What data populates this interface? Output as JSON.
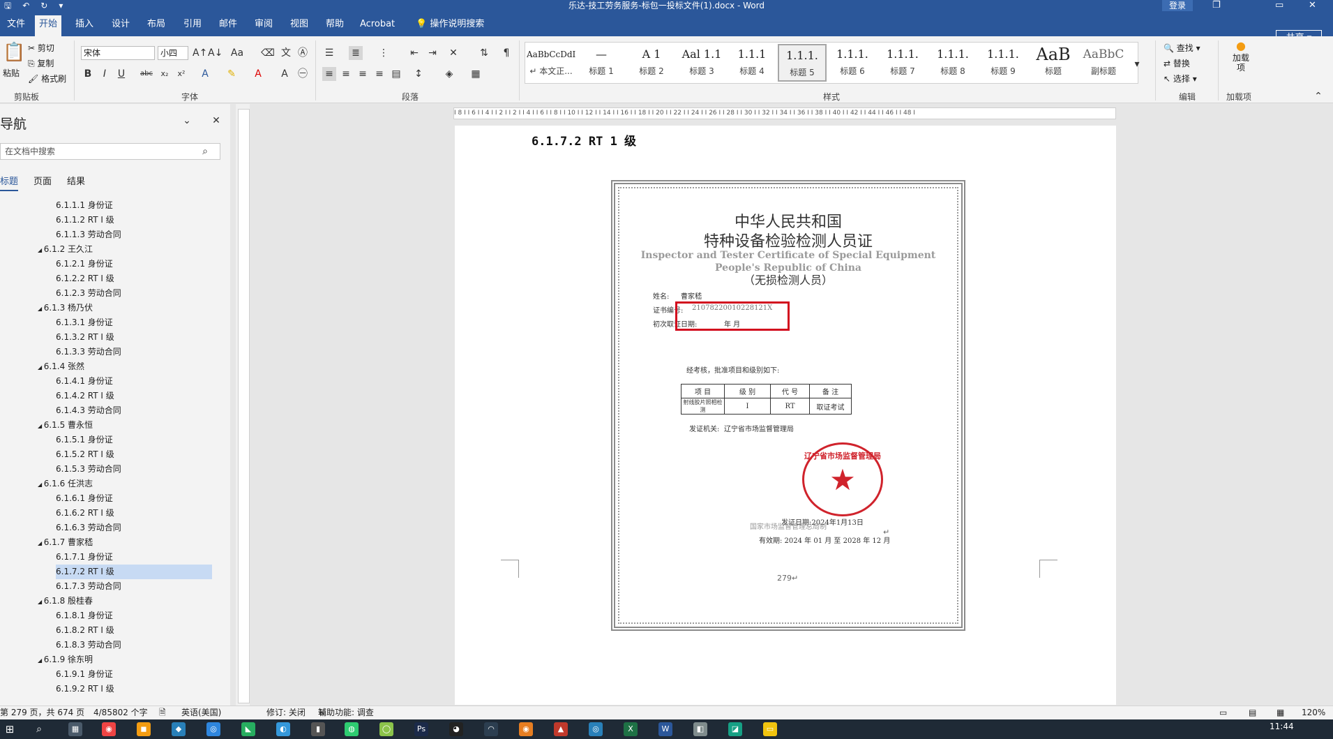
{
  "titlebar": {
    "title": "乐达-技工劳务服务-标包一投标文件(1).docx  -  Word",
    "login": "登录",
    "undo": "↶",
    "redo": "↻",
    "save": "🖫",
    "customize": "▾",
    "restore": "❐",
    "maximize": "▭",
    "close": "✕"
  },
  "tabs": [
    "文件",
    "开始",
    "插入",
    "设计",
    "布局",
    "引用",
    "邮件",
    "审阅",
    "视图",
    "帮助",
    "Acrobat",
    "操作说明搜索"
  ],
  "share": "共享",
  "ribbon": {
    "clipboard": {
      "paste": "粘贴",
      "cut": "剪切",
      "copy": "复制",
      "format_painter": "格式刷",
      "label": "剪贴板"
    },
    "font": {
      "name": "宋体",
      "size": "小四",
      "label": "字体",
      "bold": "B",
      "italic": "I",
      "underline": "U",
      "strike": "abc",
      "sub": "x₂",
      "sup": "x²"
    },
    "paragraph": {
      "label": "段落"
    },
    "styles": {
      "label": "样式",
      "items": [
        {
          "preview": "AaBbCcDdI",
          "name": "↵ 本文正..."
        },
        {
          "preview": "—",
          "name": "标题 1"
        },
        {
          "preview": "A 1",
          "name": "标题 2"
        },
        {
          "preview": "Aal 1.1",
          "name": "标题 3"
        },
        {
          "preview": "1.1.1",
          "name": "标题 4"
        },
        {
          "preview": "1.1.1.",
          "name": "标题 5"
        },
        {
          "preview": "1.1.1.",
          "name": "标题 6"
        },
        {
          "preview": "1.1.1.",
          "name": "标题 7"
        },
        {
          "preview": "1.1.1.",
          "name": "标题 8"
        },
        {
          "preview": "1.1.1.",
          "name": "标题 9"
        },
        {
          "preview": "AaB",
          "name": "标题"
        },
        {
          "preview": "AaBbC",
          "name": "副标题"
        }
      ]
    },
    "editing": {
      "find": "查找",
      "replace": "替换",
      "select": "选择",
      "label": "编辑"
    },
    "addins": {
      "btn": "加载项",
      "label": "加载项"
    }
  },
  "nav": {
    "title": "导航",
    "search_placeholder": "在文档中搜索",
    "tabs": [
      "标题",
      "页面",
      "结果"
    ],
    "tree": [
      {
        "level": 2,
        "text": "6.1.1.1 身份证"
      },
      {
        "level": 2,
        "text": "6.1.1.2 RT I 级"
      },
      {
        "level": 2,
        "text": "6.1.1.3 劳动合同"
      },
      {
        "level": 1,
        "text": "6.1.2 王久江"
      },
      {
        "level": 2,
        "text": "6.1.2.1 身份证"
      },
      {
        "level": 2,
        "text": "6.1.2.2 RT I 级"
      },
      {
        "level": 2,
        "text": "6.1.2.3 劳动合同"
      },
      {
        "level": 1,
        "text": "6.1.3 杨乃伏"
      },
      {
        "level": 2,
        "text": "6.1.3.1 身份证"
      },
      {
        "level": 2,
        "text": "6.1.3.2 RT I 级"
      },
      {
        "level": 2,
        "text": "6.1.3.3 劳动合同"
      },
      {
        "level": 1,
        "text": "6.1.4 张然"
      },
      {
        "level": 2,
        "text": "6.1.4.1 身份证"
      },
      {
        "level": 2,
        "text": "6.1.4.2 RT I 级"
      },
      {
        "level": 2,
        "text": "6.1.4.3 劳动合同"
      },
      {
        "level": 1,
        "text": "6.1.5 曹永恒"
      },
      {
        "level": 2,
        "text": "6.1.5.1 身份证"
      },
      {
        "level": 2,
        "text": "6.1.5.2 RT I 级"
      },
      {
        "level": 2,
        "text": "6.1.5.3 劳动合同"
      },
      {
        "level": 1,
        "text": "6.1.6 任洪志"
      },
      {
        "level": 2,
        "text": "6.1.6.1 身份证"
      },
      {
        "level": 2,
        "text": "6.1.6.2 RT I 级"
      },
      {
        "level": 2,
        "text": "6.1.6.3 劳动合同"
      },
      {
        "level": 1,
        "text": "6.1.7 曹家嵇"
      },
      {
        "level": 2,
        "text": "6.1.7.1 身份证"
      },
      {
        "level": 2,
        "text": "6.1.7.2 RT I 级",
        "selected": true
      },
      {
        "level": 2,
        "text": "6.1.7.3 劳动合同"
      },
      {
        "level": 1,
        "text": "6.1.8 殷桂春"
      },
      {
        "level": 2,
        "text": "6.1.8.1 身份证"
      },
      {
        "level": 2,
        "text": "6.1.8.2 RT I 级"
      },
      {
        "level": 2,
        "text": "6.1.8.3 劳动合同"
      },
      {
        "level": 1,
        "text": "6.1.9 徐东明"
      },
      {
        "level": 2,
        "text": "6.1.9.1 身份证"
      },
      {
        "level": 2,
        "text": "6.1.9.2 RT I 级"
      }
    ]
  },
  "ruler": {
    "h": "I 8 I  I 6 I  I 4 I  I 2 I    I 2 I  I 4 I  I 6 I  I 8 I  I 10 I  I 12 I  I 14 I  I 16 I  I 18 I  I 20 I  I 22 I  I 24 I  I 26 I  I 28 I  I 30 I  I 32 I  I 34 I  I 36 I  I 38 I  I 40 I  I 42 I  I 44 I  I 46 I  I 48 I"
  },
  "document": {
    "heading": "6.1.7.2 RT 1 级",
    "cert": {
      "title1": "中华人民共和国",
      "title2": "特种设备检验检测人员证",
      "en1": "Inspector and Tester Certificate of Special Equipment",
      "en2": "People's Republic of China",
      "sub": "（无损检测人员）",
      "name_label": "姓名:",
      "name": "曹家嵇",
      "cert_no_label": "证书编号:",
      "cert_no": "21078220010228121X",
      "first_date_label": "初次取证日期:",
      "first_date": "年        月",
      "approve": "经考核，批准项目和级别如下:",
      "table_head": [
        "项  目",
        "级  别",
        "代  号",
        "备  注"
      ],
      "table_row": [
        "射线胶片照相检测",
        "I",
        "RT",
        "取证考试"
      ],
      "issuer_label": "发证机关:",
      "issuer": "辽宁省市场监督管理局",
      "stamp_text": "辽宁省市场监督管理局",
      "issue_date": "发证日期:2024年1月13日",
      "valid": "有效期: 2024 年 01 月 至 2028 年 12 月",
      "footer": "国家市场监督管理总局制"
    },
    "page_num": "279↵"
  },
  "status": {
    "page": "第 279 页，共 674 页",
    "words": "4/85802 个字",
    "lang": "英语(美国)",
    "track": "修订: 关闭",
    "access": "辅助功能: 调查",
    "zoom": "120%"
  },
  "taskbar": {
    "time": "11:44"
  }
}
